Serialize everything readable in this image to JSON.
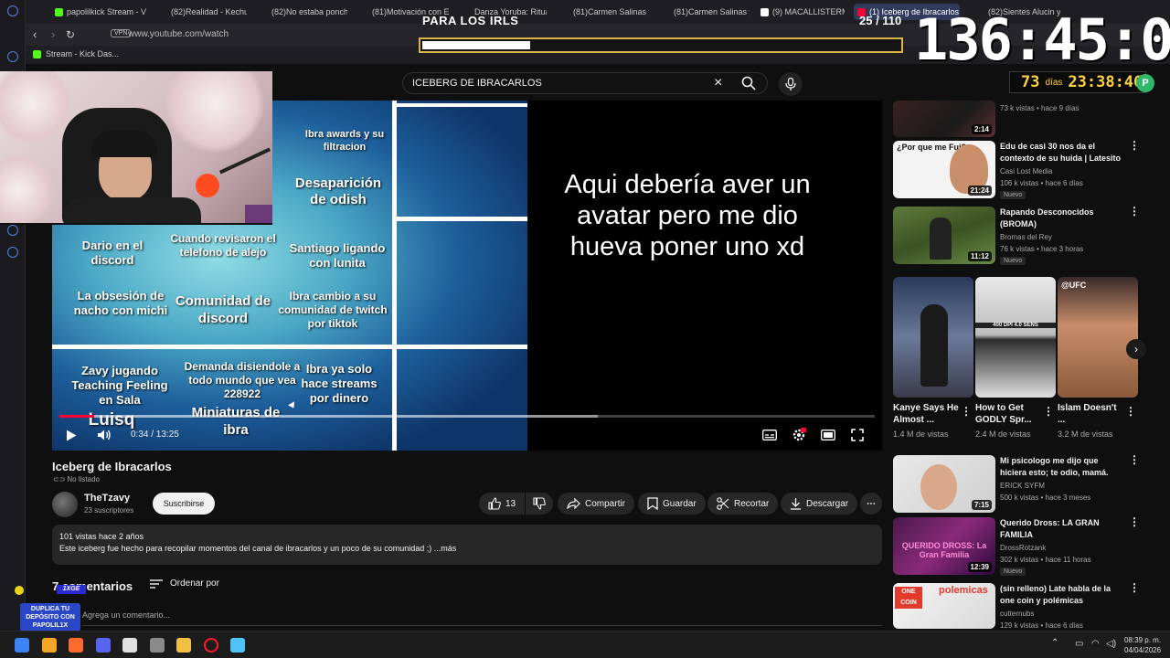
{
  "browser": {
    "tabs": [
      {
        "label": "papolilkick Stream - V",
        "color": "#53fc18"
      },
      {
        "label": "(82)Realidad - Kechu",
        "color": "#1f1f23"
      },
      {
        "label": "(82)No estaba ponch",
        "color": "#1f1f23"
      },
      {
        "label": "(81)Motivación con E",
        "color": "#1f1f23"
      },
      {
        "label": "Danza Yoruba: Ritual",
        "color": "#1f1f23"
      },
      {
        "label": "(81)Carmen Salinas y",
        "color": "#1f1f23"
      },
      {
        "label": "(81)Carmen Salinas y",
        "color": "#1f1f23"
      },
      {
        "label": "(9) MACALLISTERMA",
        "color": "#ffffff"
      },
      {
        "label": "(1) Iceberg de Ibracarlos -",
        "color": "#ff0033"
      },
      {
        "label": "(82)Sientes Alucin y",
        "color": "#1f1f23"
      }
    ],
    "vpn_label": "VPN",
    "url": "www.youtube.com/watch",
    "bookmark": "Stream - Kick Das..."
  },
  "overlay": {
    "goal_title": "PARA LOS IRLS",
    "goal_count": "25 / 110",
    "goal_progress": 0.227,
    "subathon_timer": "136:45:06",
    "countdown_days": "73",
    "countdown_days_label": "días",
    "countdown_time": "23:38:46",
    "countdown_badge": "P"
  },
  "youtube": {
    "search_value": "ICEBERG DE IBRACARLOS",
    "player": {
      "iceberg_labels": [
        "Ibra awards y su filtracion",
        "Desaparición de odish",
        "Dario en el discord",
        "Cuando revisaron el telefono de alejo",
        "Santiago ligando con lunita",
        "La obsesión de nacho con michi",
        "Comunidad de discord",
        "Ibra cambio a su comunidad de twitch por tiktok",
        "Zavy jugando Teaching Feeling en Sala",
        "Demanda disiendole a todo mundo que vea 228922",
        "Ibra ya solo hace streams por dinero",
        "Miniaturas de ibra",
        "Luisq"
      ],
      "overlay_text": "Aqui debería aver un avatar pero me dio hueva poner uno xd",
      "time_display": "0:34 / 13:25",
      "played_fraction": 0.0423,
      "buffered_fraction": 0.66
    },
    "video": {
      "title": "Iceberg de Ibracarlos",
      "visibility": "No listado",
      "channel_name": "TheTzavy",
      "channel_subs": "23 suscriptores",
      "subscribe_label": "Suscribirse",
      "likes": "13",
      "share_label": "Compartir",
      "save_label": "Guardar",
      "clip_label": "Recortar",
      "download_label": "Descargar",
      "desc_stats": "101 vistas  hace 2 años",
      "desc_text": "Este iceberg fue hecho para recopilar momentos del canal de ibracarlos y un poco de su comunidad ;) ...más"
    },
    "comments": {
      "title": "7 comentarios",
      "sort_label": "Ordenar por",
      "input_placeholder": "Agrega un comentario..."
    },
    "recommendations": [
      {
        "title": "",
        "channel": "",
        "meta": "73 k vistas • hace 9 días",
        "duration": "2:14",
        "new": ""
      },
      {
        "title": "Edu de casi 30 nos da el contexto de su huida | Latesito",
        "channel": "Casi Lost Media",
        "meta": "106 k vistas • hace 6 días",
        "duration": "21:24",
        "new": "Nuevo",
        "thumb_caption": "¿Por que me Fui?"
      },
      {
        "title": "Rapando Desconocidos (BROMA)",
        "channel": "Bromas del Rey",
        "meta": "76 k vistas • hace 3 horas",
        "duration": "11:12",
        "new": "Nuevo"
      },
      {
        "title": "Mi psicologo me dijo que hiciera esto; te odio, mamá.",
        "channel": "ERICK SYFM",
        "meta": "500 k vistas • hace 3 meses",
        "duration": "7:15",
        "new": ""
      },
      {
        "title": "Querido Dross: LA GRAN FAMILIA",
        "channel": "DrossRotzank",
        "meta": "302 k vistas • hace 11 horas",
        "duration": "12:39",
        "new": "Nuevo",
        "thumb_caption": "QUERIDO DROSS: La Gran Familia"
      },
      {
        "title": "(sin relleno) Late habla de la one coin y polémicas",
        "channel": "cutternubs",
        "meta": "129 k vistas • hace 6 días",
        "duration": "",
        "new": "",
        "thumb_caption": "polemicas"
      }
    ],
    "shorts": [
      {
        "title": "Kanye Says He Almost ...",
        "views": "1.4 M de vistas"
      },
      {
        "title": "How to Get GODLY Spr...",
        "views": "2.4 M de vistas",
        "thumb_caption": "400 DPI 4.0 SENS"
      },
      {
        "title": "Islam Doesn't ...",
        "views": "3.2 M de vistas",
        "thumb_caption": "@UFC"
      }
    ]
  },
  "promo": {
    "ribbon": "1XGE",
    "text": "DUPLICA TU DEPÓSITO CON PAPOLIL1X"
  },
  "taskbar": {
    "time": "08:39 p. m.",
    "date": "04/04/2026",
    "icon_colors": [
      "#3b82f6",
      "#f5a623",
      "#ff6b2c",
      "#5865f2",
      "#e0e0e0",
      "#8a8a8a",
      "#f0c040",
      "#ff1b2d",
      "#4fc3f7"
    ]
  }
}
